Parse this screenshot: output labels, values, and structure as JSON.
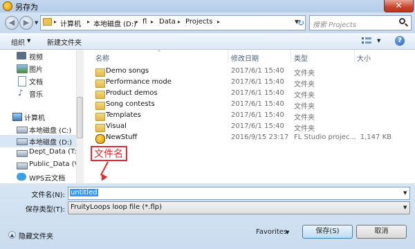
{
  "window": {
    "title": "另存为",
    "close": "✕"
  },
  "address": {
    "breadcrumbs": [
      "计算机",
      "本地磁盘 (D:)",
      "fl",
      "Data",
      "Projects"
    ],
    "separator": "▸",
    "search_placeholder": "搜索 Projects"
  },
  "toolbar": {
    "organize": "组织",
    "new_folder": "新建文件夹",
    "help": "?"
  },
  "sidebar": {
    "items": [
      {
        "label": "视频",
        "icon": "video-icon"
      },
      {
        "label": "图片",
        "icon": "pictures-icon"
      },
      {
        "label": "文档",
        "icon": "documents-icon"
      },
      {
        "label": "音乐",
        "icon": "music-icon"
      },
      {
        "label": "计算机",
        "icon": "computer-icon"
      },
      {
        "label": "本地磁盘 (C:)",
        "icon": "drive-icon"
      },
      {
        "label": "本地磁盘 (D:)",
        "icon": "drive-icon"
      },
      {
        "label": "Dept_Data (T:)",
        "icon": "network-drive-icon"
      },
      {
        "label": "Public_Data (V:)",
        "icon": "network-drive-icon"
      },
      {
        "label": "WPS云文档",
        "icon": "cloud-icon"
      }
    ]
  },
  "filelist": {
    "columns": {
      "name": "名称",
      "date": "修改日期",
      "type": "类型",
      "size": "大小"
    },
    "rows": [
      {
        "name": "Demo songs",
        "date": "2017/6/1 15:40",
        "type": "文件夹",
        "size": "",
        "kind": "folder"
      },
      {
        "name": "Performance mode",
        "date": "2017/6/1 15:40",
        "type": "文件夹",
        "size": "",
        "kind": "folder"
      },
      {
        "name": "Product demos",
        "date": "2017/6/1 15:40",
        "type": "文件夹",
        "size": "",
        "kind": "folder"
      },
      {
        "name": "Song contests",
        "date": "2017/6/1 15:40",
        "type": "文件夹",
        "size": "",
        "kind": "folder"
      },
      {
        "name": "Templates",
        "date": "2017/6/1 15:40",
        "type": "文件夹",
        "size": "",
        "kind": "folder"
      },
      {
        "name": "Visual",
        "date": "2017/6/1 15:40",
        "type": "文件夹",
        "size": "",
        "kind": "folder"
      },
      {
        "name": "NewStuff",
        "date": "2016/9/15 23:17",
        "type": "FL Studio projec...",
        "size": "1,147 KB",
        "kind": "flp"
      }
    ]
  },
  "annotation": {
    "text": "文件名",
    "color": "#e8262d"
  },
  "form": {
    "filename_label": "文件名(N):",
    "filename_value": "untitled",
    "filetype_label": "保存类型(T):",
    "filetype_value": "FruityLoops loop file (*.flp)"
  },
  "footer": {
    "hide_folders": "隐藏文件夹",
    "favorites": "Favorites",
    "save": "保存(S)",
    "cancel": "取消"
  }
}
